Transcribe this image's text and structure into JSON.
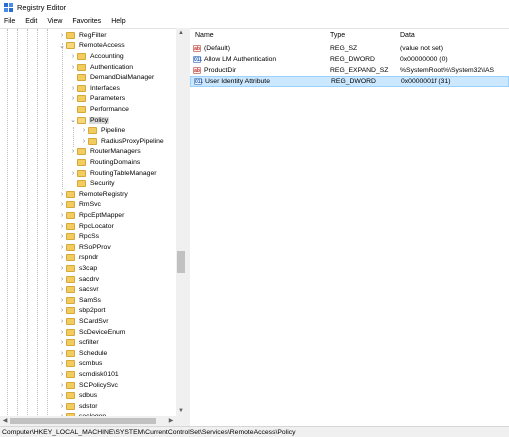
{
  "window": {
    "title": "Registry Editor"
  },
  "menu": [
    "File",
    "Edit",
    "View",
    "Favorites",
    "Help"
  ],
  "tree": [
    {
      "label": "RegFilter",
      "expander": ">",
      "depth": 0,
      "open": false,
      "selected": false
    },
    {
      "label": "RemoteAccess",
      "expander": "v",
      "depth": 0,
      "open": true,
      "selected": false
    },
    {
      "label": "Accounting",
      "expander": ">",
      "depth": 1,
      "open": false,
      "selected": false
    },
    {
      "label": "Authentication",
      "expander": ">",
      "depth": 1,
      "open": false,
      "selected": false
    },
    {
      "label": "DemandDialManager",
      "expander": "",
      "depth": 1,
      "open": false,
      "selected": false
    },
    {
      "label": "Interfaces",
      "expander": ">",
      "depth": 1,
      "open": false,
      "selected": false
    },
    {
      "label": "Parameters",
      "expander": ">",
      "depth": 1,
      "open": false,
      "selected": false
    },
    {
      "label": "Performance",
      "expander": "",
      "depth": 1,
      "open": false,
      "selected": false
    },
    {
      "label": "Policy",
      "expander": "v",
      "depth": 1,
      "open": true,
      "selected": true
    },
    {
      "label": "Pipeline",
      "expander": ">",
      "depth": 2,
      "open": false,
      "selected": false
    },
    {
      "label": "RadiusProxyPipeline",
      "expander": ">",
      "depth": 2,
      "open": false,
      "selected": false
    },
    {
      "label": "RouterManagers",
      "expander": ">",
      "depth": 1,
      "open": false,
      "selected": false
    },
    {
      "label": "RoutingDomains",
      "expander": "",
      "depth": 1,
      "open": false,
      "selected": false
    },
    {
      "label": "RoutingTableManager",
      "expander": ">",
      "depth": 1,
      "open": false,
      "selected": false
    },
    {
      "label": "Security",
      "expander": "",
      "depth": 1,
      "open": false,
      "selected": false
    },
    {
      "label": "RemoteRegistry",
      "expander": ">",
      "depth": 0,
      "open": false,
      "selected": false
    },
    {
      "label": "RmSvc",
      "expander": ">",
      "depth": 0,
      "open": false,
      "selected": false
    },
    {
      "label": "RpcEptMapper",
      "expander": ">",
      "depth": 0,
      "open": false,
      "selected": false
    },
    {
      "label": "RpcLocator",
      "expander": ">",
      "depth": 0,
      "open": false,
      "selected": false
    },
    {
      "label": "RpcSs",
      "expander": ">",
      "depth": 0,
      "open": false,
      "selected": false
    },
    {
      "label": "RSoPProv",
      "expander": ">",
      "depth": 0,
      "open": false,
      "selected": false
    },
    {
      "label": "rspndr",
      "expander": ">",
      "depth": 0,
      "open": false,
      "selected": false
    },
    {
      "label": "s3cap",
      "expander": ">",
      "depth": 0,
      "open": false,
      "selected": false
    },
    {
      "label": "sacdrv",
      "expander": ">",
      "depth": 0,
      "open": false,
      "selected": false
    },
    {
      "label": "sacsvr",
      "expander": ">",
      "depth": 0,
      "open": false,
      "selected": false
    },
    {
      "label": "SamSs",
      "expander": ">",
      "depth": 0,
      "open": false,
      "selected": false
    },
    {
      "label": "sbp2port",
      "expander": ">",
      "depth": 0,
      "open": false,
      "selected": false
    },
    {
      "label": "SCardSvr",
      "expander": ">",
      "depth": 0,
      "open": false,
      "selected": false
    },
    {
      "label": "ScDeviceEnum",
      "expander": ">",
      "depth": 0,
      "open": false,
      "selected": false
    },
    {
      "label": "scfilter",
      "expander": ">",
      "depth": 0,
      "open": false,
      "selected": false
    },
    {
      "label": "Schedule",
      "expander": ">",
      "depth": 0,
      "open": false,
      "selected": false
    },
    {
      "label": "scmbus",
      "expander": ">",
      "depth": 0,
      "open": false,
      "selected": false
    },
    {
      "label": "scmdisk0101",
      "expander": ">",
      "depth": 0,
      "open": false,
      "selected": false
    },
    {
      "label": "SCPolicySvc",
      "expander": ">",
      "depth": 0,
      "open": false,
      "selected": false
    },
    {
      "label": "sdbus",
      "expander": ">",
      "depth": 0,
      "open": false,
      "selected": false
    },
    {
      "label": "sdstor",
      "expander": ">",
      "depth": 0,
      "open": false,
      "selected": false
    },
    {
      "label": "seclogon",
      "expander": ">",
      "depth": 0,
      "open": false,
      "selected": false
    }
  ],
  "list": {
    "columns": {
      "name": "Name",
      "type": "Type",
      "data": "Data"
    },
    "rows": [
      {
        "icon": "string-value-icon",
        "icon_text": "ab",
        "kind": "str",
        "name": "(Default)",
        "type": "REG_SZ",
        "data": "(value not set)",
        "selected": false
      },
      {
        "icon": "dword-value-icon",
        "icon_text": "011",
        "kind": "dw",
        "name": "Allow LM Authentication",
        "type": "REG_DWORD",
        "data": "0x00000000 (0)",
        "selected": false
      },
      {
        "icon": "string-value-icon",
        "icon_text": "ab",
        "kind": "str",
        "name": "ProductDir",
        "type": "REG_EXPAND_SZ",
        "data": "%SystemRoot%\\System32\\IAS",
        "selected": false
      },
      {
        "icon": "dword-value-icon",
        "icon_text": "011",
        "kind": "dw",
        "name": "User Identity Attribute",
        "type": "REG_DWORD",
        "data": "0x0000001f (31)",
        "selected": true
      }
    ]
  },
  "status": {
    "path": "Computer\\HKEY_LOCAL_MACHINE\\SYSTEM\\CurrentControlSet\\Services\\RemoteAccess\\Policy"
  },
  "colors": {
    "selection": "#cce8ff",
    "tree_selection": "#d9d9d9",
    "folder": "#f3cc5f"
  }
}
